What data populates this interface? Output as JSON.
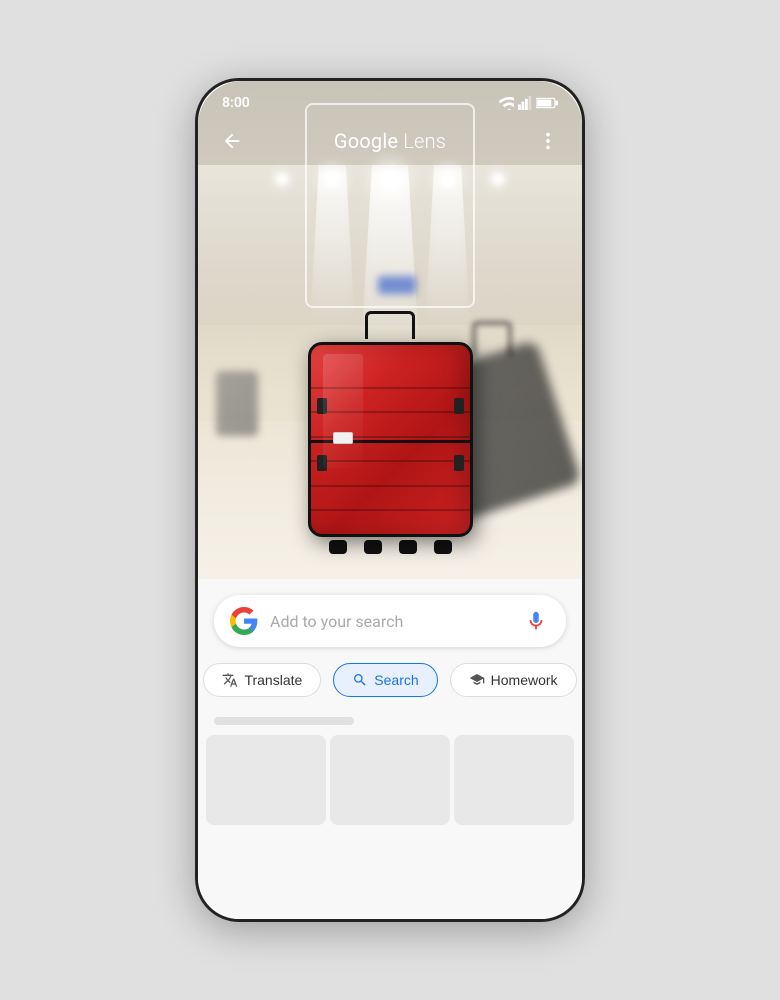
{
  "phone": {
    "status_bar": {
      "time": "8:00"
    },
    "top_bar": {
      "title_google": "Google",
      "title_lens": " Lens",
      "back_button_label": "back",
      "more_button_label": "more options"
    },
    "search_bar": {
      "placeholder": "Add to your search",
      "mic_label": "voice search"
    },
    "tabs": [
      {
        "id": "translate",
        "label": "Translate",
        "icon": "translate-icon",
        "active": false
      },
      {
        "id": "search",
        "label": "Search",
        "icon": "search-icon",
        "active": true
      },
      {
        "id": "homework",
        "label": "Homework",
        "icon": "homework-icon",
        "active": false
      }
    ],
    "colors": {
      "active_tab": "#1a73e8",
      "active_tab_bg": "#e8f0fe",
      "mic_blue": "#4285f4",
      "mic_red": "#ea4335"
    }
  }
}
